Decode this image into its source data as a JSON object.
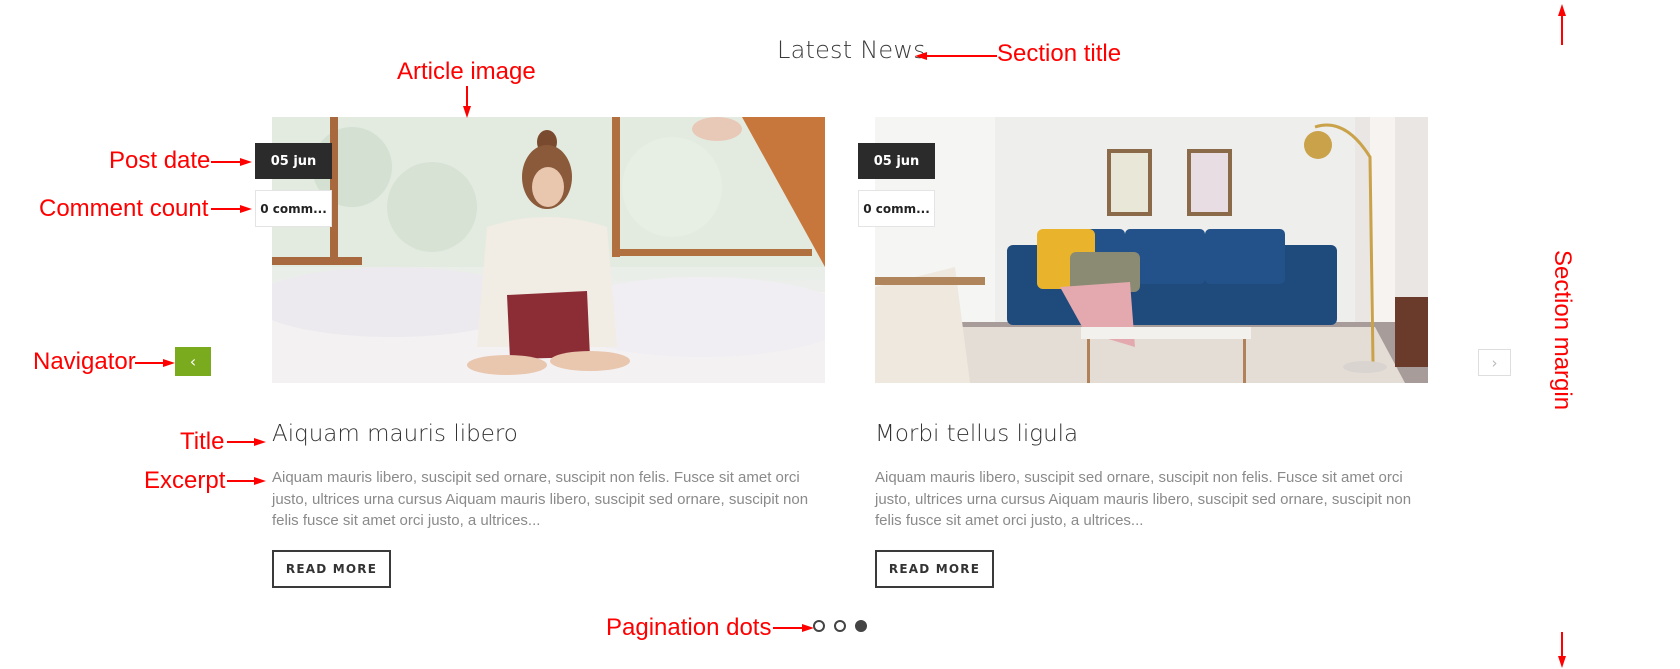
{
  "section": {
    "title": "Latest News"
  },
  "navigation": {
    "prev_icon": "‹",
    "next_icon": "›",
    "prev_color": "#7aab1e"
  },
  "articles": [
    {
      "date": "05 jun",
      "comments": "0 comm...",
      "image": "woman-with-laptop-on-bed",
      "title": "Aiquam mauris libero",
      "excerpt": "Aiquam mauris libero, suscipit sed ornare, suscipit non felis. Fusce sit amet orci justo, ultrices urna cursus Aiquam mauris libero, suscipit sed ornare, suscipit non felis fusce sit amet orci justo, a ultrices...",
      "read_more": "READ MORE"
    },
    {
      "date": "05 jun",
      "comments": "0 comm...",
      "image": "living-room-blue-sofa",
      "title": "Morbi tellus ligula",
      "excerpt": "Aiquam mauris libero, suscipit sed ornare, suscipit non felis. Fusce sit amet orci justo, ultrices urna cursus Aiquam mauris libero, suscipit sed ornare, suscipit non felis fusce sit amet orci justo, a ultrices...",
      "read_more": "READ MORE"
    }
  ],
  "pagination": {
    "pages": 3,
    "active": 3
  },
  "annotations": {
    "section_title": "Section title",
    "article_image": "Article image",
    "post_date": "Post date",
    "comment_count": "Comment count",
    "navigator": "Navigator",
    "title": "Title",
    "excerpt": "Excerpt",
    "pagination_dots": "Pagination dots",
    "section_margin": "Section margin",
    "color": "#ff0000"
  }
}
